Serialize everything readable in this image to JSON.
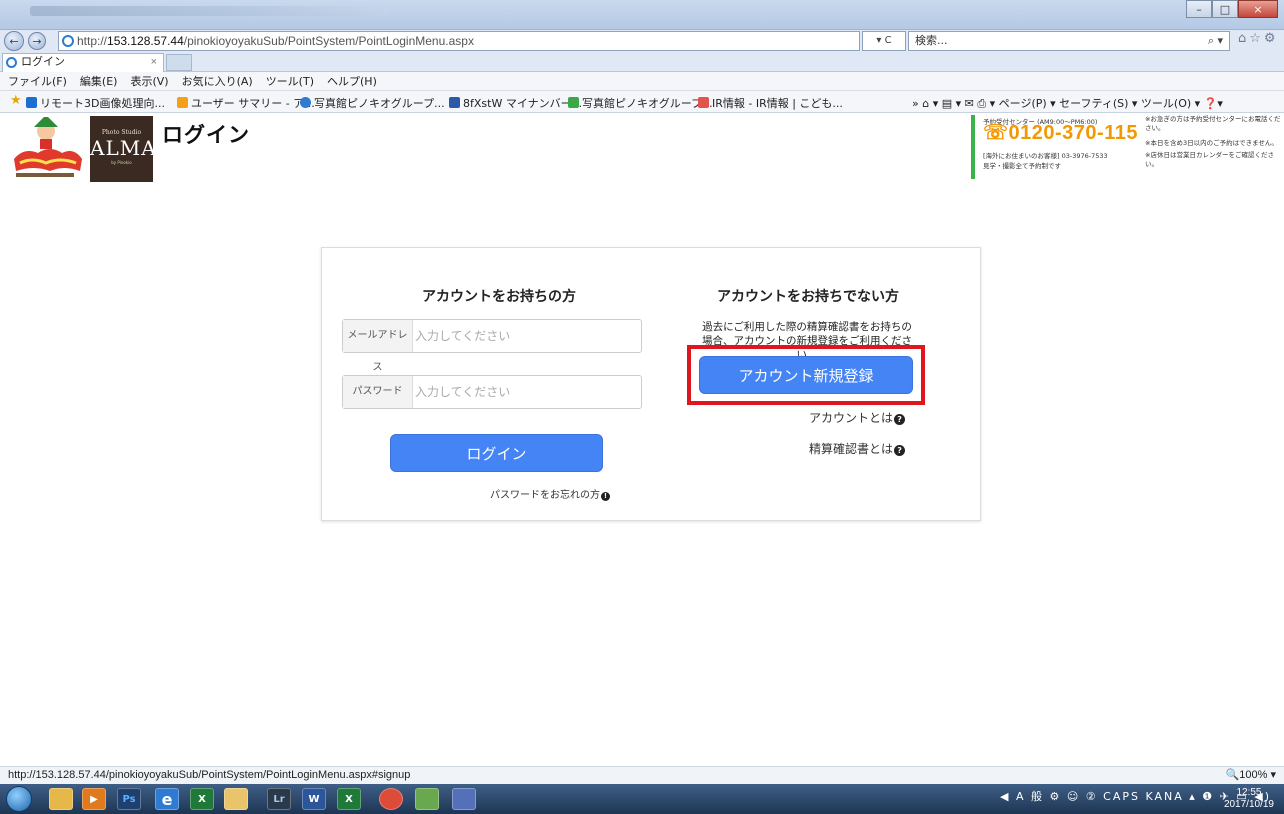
{
  "browser": {
    "url_prefix": "http://",
    "url_host": "153.128.57.44",
    "url_path": "/pinokioyoyakuSub/PointSystem/PointLoginMenu.aspx",
    "refresh_symbol": "▾ C",
    "search_placeholder": "検索...",
    "tab_title": "ログイン",
    "tab_close": "×",
    "back_icon": "←",
    "forward_icon": "→",
    "minimize": "–",
    "maximize": "□",
    "close": "×",
    "right_icons": "⌂☆⚙"
  },
  "menu": {
    "items": [
      "ファイル(F)",
      "編集(E)",
      "表示(V)",
      "お気に入り(A)",
      "ツール(T)",
      "ヘルプ(H)"
    ]
  },
  "favorites": {
    "items": [
      {
        "label": "リモート3D画像処理向...",
        "color": "#1a6fd0"
      },
      {
        "label": "ユーザー サマリー - ア...",
        "color": "#f4a018"
      },
      {
        "label": "写真館ピノキオグループ...",
        "color": "#2f7bd1"
      },
      {
        "label": "8fXstW マイナンバー...",
        "color": "#2b5aa8"
      },
      {
        "label": "写真館ピノキオグループ...",
        "color": "#39a845"
      },
      {
        "label": "IR情報 - IR情報 | こども...",
        "color": "#e0544c"
      }
    ],
    "command_bar": "»  ⌂ ▾  ▤ ▾  ✉  ⎙ ▾  ページ(P) ▾  セーフティ(S) ▾  ツール(O) ▾  ❓▾"
  },
  "header": {
    "page_title": "ログイン",
    "brand_photo_studio": "Photo Studio",
    "brand_name": "ALMA",
    "brand_by": "by Pinokio",
    "contact": {
      "center_label": "予約受付センター (AM9:00～PM6:00)",
      "phone": "0120-370-115",
      "overseas": "[海外にお住まいのお客様] 03-3976-7533",
      "note": "見学・撮影全て予約制です",
      "notice1": "※お急ぎの方は予約受付センターにお電話ください。",
      "notice2": "※本日を含め3日以内のご予約はできません。",
      "notice3": "※店休日は営業日カレンダーをご確認ください。"
    }
  },
  "login": {
    "title": "アカウントをお持ちの方",
    "email_label": "メールアドレス",
    "email_placeholder": "入力してください",
    "password_label": "パスワード",
    "password_placeholder": "入力してください",
    "login_button": "ログイン",
    "forgot_password": "パスワードをお忘れの方"
  },
  "signup": {
    "title": "アカウントをお持ちでない方",
    "description": "過去にご利用した際の精算確認書をお持ちの場合、アカウントの新規登録をご利用ください。",
    "register_button": "アカウント新規登録",
    "about_account": "アカウントとは",
    "about_receipt": "精算確認書とは"
  },
  "status_bar": {
    "url": "http://153.128.57.44/pinokioyoyakuSub/PointSystem/PointLoginMenu.aspx#signup",
    "zoom": "100%"
  },
  "taskbar": {
    "apps": [
      {
        "name": "explorer",
        "label": "",
        "color": "#e6b84a"
      },
      {
        "name": "media",
        "label": "▶",
        "color": "#e07a1f"
      },
      {
        "name": "photoshop",
        "label": "Ps",
        "color": "#1f3f6e"
      },
      {
        "name": "ie",
        "label": "e",
        "color": "#2f7bd1"
      },
      {
        "name": "excel",
        "label": "X",
        "color": "#1f7a3a"
      },
      {
        "name": "folder",
        "label": "",
        "color": "#e9c46a"
      },
      {
        "name": "lightroom",
        "label": "Lr",
        "color": "#2b3a4a"
      },
      {
        "name": "word",
        "label": "W",
        "color": "#2b579a"
      },
      {
        "name": "excel2",
        "label": "X",
        "color": "#1f7a3a"
      },
      {
        "name": "chrome",
        "label": "",
        "color": "#dd4b39"
      },
      {
        "name": "pinokio",
        "label": "",
        "color": "#6aa84f"
      },
      {
        "name": "app",
        "label": "",
        "color": "#5470b8"
      }
    ],
    "tray": "◀ A 般 ⚙ ☺ ② CAPS KANA ▴ ❶ ✈ ▭ ◀)",
    "time": "12:55",
    "date": "2017/10/19"
  }
}
